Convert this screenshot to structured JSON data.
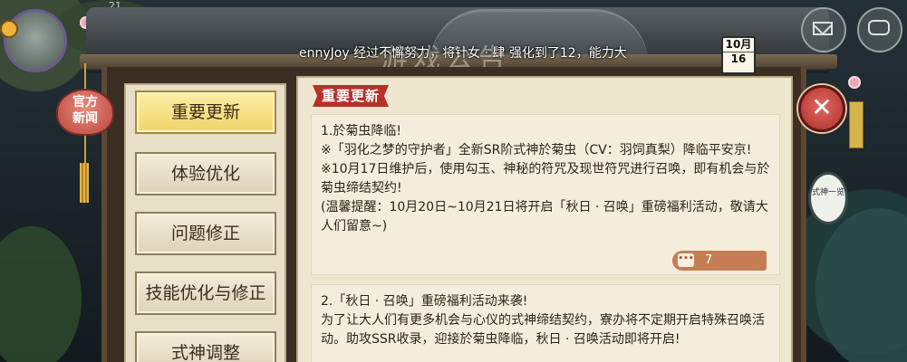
{
  "status_bar": {
    "text": "21"
  },
  "header": {
    "title": "游戏公告",
    "marquee": "ennyJoy 经过不懈努力，将针女 · 肆 强化到了12，能力大",
    "calendar": {
      "month": "10月",
      "day": "16"
    }
  },
  "lantern": {
    "line1": "官方",
    "line2": "新闻"
  },
  "nav": {
    "items": [
      {
        "label": "重要更新",
        "active": true
      },
      {
        "label": "体验优化",
        "active": false
      },
      {
        "label": "问题修正",
        "active": false
      },
      {
        "label": "技能优化与修正",
        "active": false
      },
      {
        "label": "式神调整",
        "active": false
      }
    ]
  },
  "content": {
    "section_title": "重要更新",
    "articles": [
      {
        "lines": [
          "1.於菊虫降临!",
          "※「羽化之梦的守护者」全新SR阶式神於菊虫（CV：羽饲真梨）降临平安京!",
          "※10月17日维护后，使用勾玉、神秘的符咒及现世符咒进行召唤，即有机会与於菊虫缔结契约!",
          "(温馨提醒：10月20日~10月21日将开启「秋日 · 召唤」重磅福利活动，敬请大人们留意~)"
        ],
        "comment_count": "7"
      },
      {
        "lines": [
          "2.「秋日 · 召唤」重磅福利活动来袭!",
          "为了让大人们有更多机会与心仪的式神缔结契约，寮办将不定期开启特殊召唤活动。助攻SSR收录，迎接於菊虫降临，秋日 · 召唤活动即将开启!"
        ]
      }
    ]
  },
  "right": {
    "scroll_text": "式神一览"
  },
  "colors": {
    "accent_red": "#b6312a",
    "active_tab": "#f1d56a",
    "panel_bg": "#efe6cf",
    "comment_pill": "#c77d53"
  },
  "icons": [
    "avatar",
    "lantern-icon",
    "calendar-icon",
    "close-icon",
    "mail-icon",
    "chat-icon",
    "comment-icon"
  ]
}
